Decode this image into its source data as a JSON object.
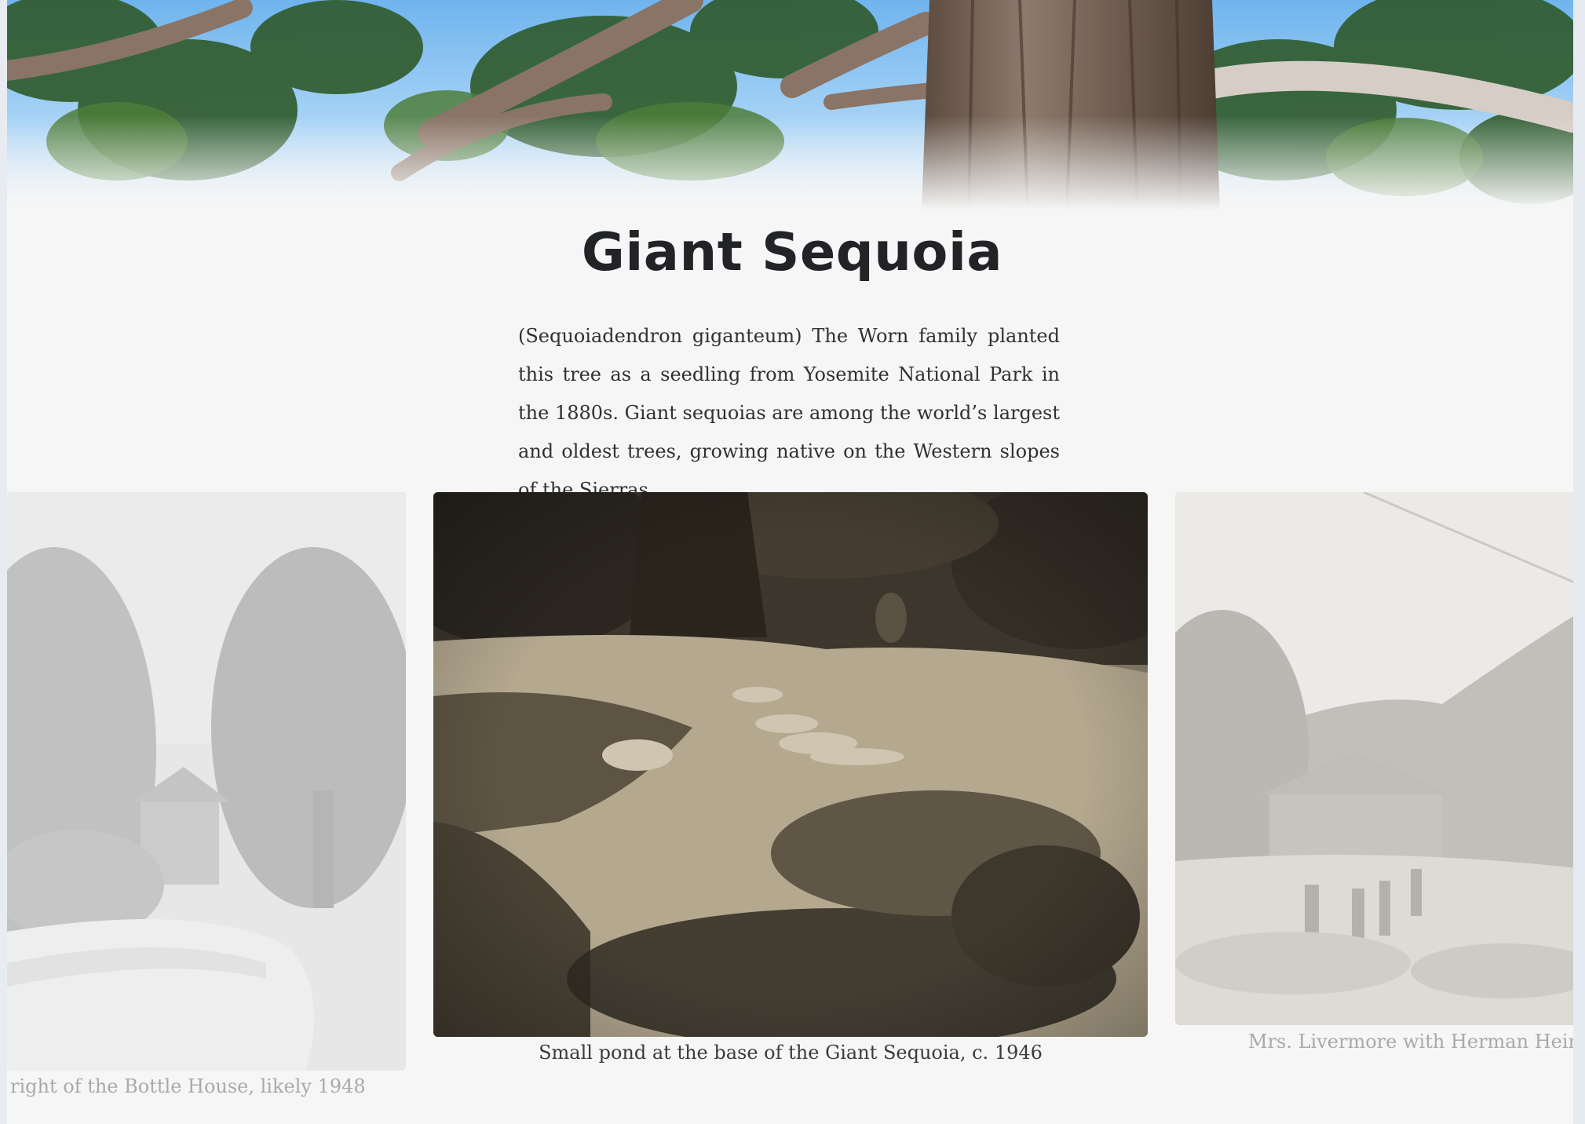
{
  "title": "Giant Sequoia",
  "description": "(Sequoiadendron giganteum) The Worn family planted this tree as a seedling from Yosemite National Park in the 1880s. Giant sequoias are among the world’s largest and oldest trees, growing native on the Western slopes of the Sierras.",
  "gallery": {
    "slides": [
      {
        "caption": "right of the Bottle House, likely 1948",
        "state": "faded"
      },
      {
        "caption": "Small pond at the base of the Giant Sequoia, c. 1946",
        "state": "active"
      },
      {
        "caption": "Mrs. Livermore with Herman Hein, I",
        "state": "faded"
      }
    ]
  },
  "colors": {
    "background": "#f6f6f6",
    "title": "#222327",
    "text": "#2f3033",
    "sky": "#7fbfef",
    "sepia": "#6f6452"
  }
}
